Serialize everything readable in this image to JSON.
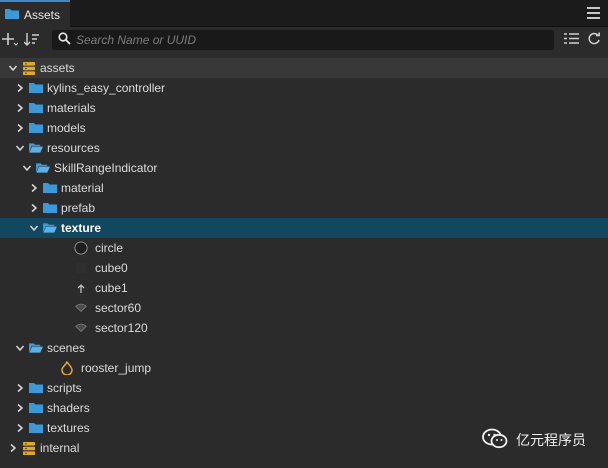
{
  "panel": {
    "tab_label": "Assets",
    "tab_icon": "folder-icon",
    "menu_icon": "hamburger-icon"
  },
  "toolbar": {
    "add_icon": "plus-icon",
    "sort_icon": "sort-icon",
    "search_placeholder": "Search Name or UUID",
    "collapse_icon": "collapse-list-icon",
    "refresh_icon": "refresh-icon"
  },
  "colors": {
    "folder": "#3a9ad9",
    "selection": "#124760",
    "db": "#e0a92b",
    "scene": "#e8a33c"
  },
  "tree": [
    {
      "label": "assets",
      "depth": 0,
      "arrow": "down",
      "icon": "database-icon"
    },
    {
      "label": "kylins_easy_controller",
      "depth": 1,
      "arrow": "right",
      "icon": "folder-icon"
    },
    {
      "label": "materials",
      "depth": 1,
      "arrow": "right",
      "icon": "folder-icon"
    },
    {
      "label": "models",
      "depth": 1,
      "arrow": "right",
      "icon": "folder-icon"
    },
    {
      "label": "resources",
      "depth": 1,
      "arrow": "down",
      "icon": "folder-open-icon"
    },
    {
      "label": "SkillRangeIndicator",
      "depth": 2,
      "arrow": "down",
      "icon": "folder-open-icon"
    },
    {
      "label": "material",
      "depth": 3,
      "arrow": "right",
      "icon": "folder-icon"
    },
    {
      "label": "prefab",
      "depth": 3,
      "arrow": "right",
      "icon": "folder-icon"
    },
    {
      "label": "texture",
      "depth": 3,
      "arrow": "down",
      "icon": "folder-open-icon",
      "selected": true
    },
    {
      "label": "circle",
      "depth": 4,
      "arrow": "",
      "icon": "circle-texture-icon"
    },
    {
      "label": "cube0",
      "depth": 4,
      "arrow": "",
      "icon": "cube-texture-icon"
    },
    {
      "label": "cube1",
      "depth": 4,
      "arrow": "",
      "icon": "arrow-up-texture-icon"
    },
    {
      "label": "sector60",
      "depth": 4,
      "arrow": "",
      "icon": "sector-texture-icon"
    },
    {
      "label": "sector120",
      "depth": 4,
      "arrow": "",
      "icon": "sector-texture-icon"
    },
    {
      "label": "scenes",
      "depth": 1,
      "arrow": "down",
      "icon": "folder-open-icon"
    },
    {
      "label": "rooster_jump",
      "depth": 2,
      "arrow": "",
      "icon": "scene-icon"
    },
    {
      "label": "scripts",
      "depth": 1,
      "arrow": "right",
      "icon": "folder-icon"
    },
    {
      "label": "shaders",
      "depth": 1,
      "arrow": "right",
      "icon": "folder-icon"
    },
    {
      "label": "textures",
      "depth": 1,
      "arrow": "right",
      "icon": "folder-icon"
    },
    {
      "label": "internal",
      "depth": 0,
      "arrow": "right",
      "icon": "database-icon"
    }
  ],
  "watermark": {
    "text": "亿元程序员",
    "icon": "wechat-icon"
  }
}
